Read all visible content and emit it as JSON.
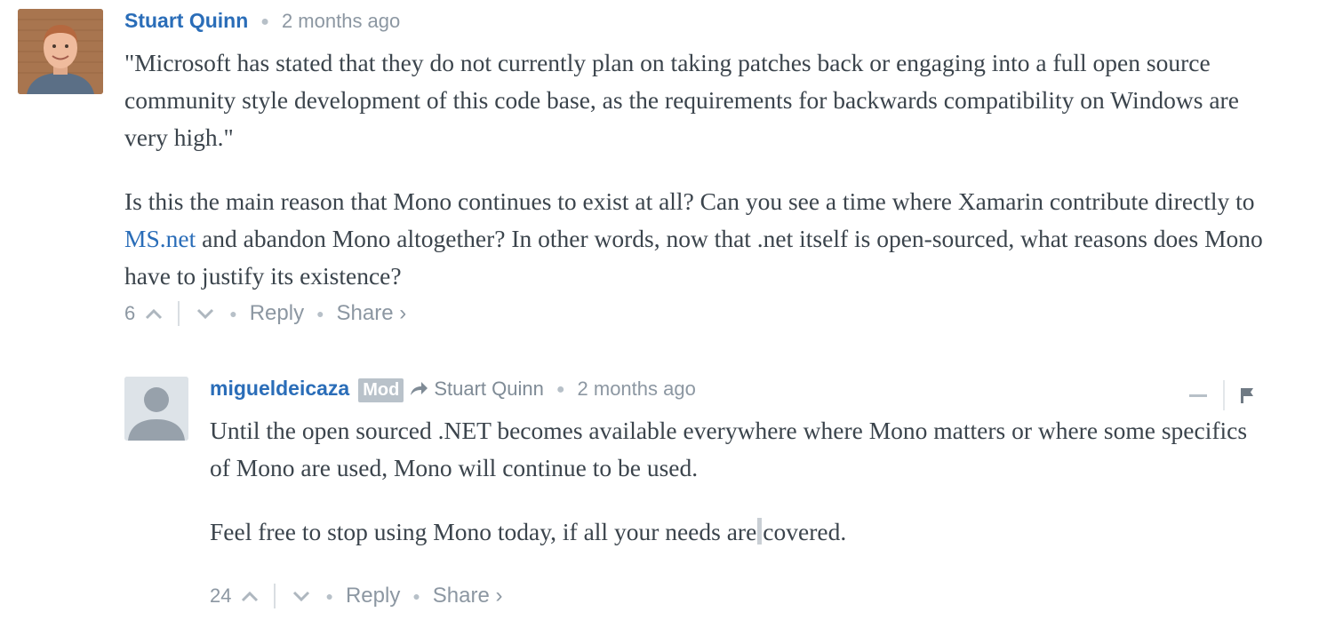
{
  "comments": [
    {
      "author": "Stuart Quinn",
      "time": "2 months ago",
      "avatar_icon": "user-photo",
      "body": {
        "p1": "\"Microsoft has stated that they do not currently plan on taking patches back or engaging into a full open source community style development of this code base, as the requirements for backwards compatibility on Windows are very high.\"",
        "p2_before": "Is this the main reason that Mono continues to exist at all? Can you see a time where Xamarin contribute directly to ",
        "p2_link": "MS.net",
        "p2_after": " and abandon Mono altogether? In other words, now that .net itself is open-sourced, what reasons does Mono have to justify its existence?"
      },
      "votes": "6",
      "reply_label": "Reply",
      "share_label": "Share ›"
    },
    {
      "author": "migueldeicaza",
      "badge": "Mod",
      "reply_to": "Stuart Quinn",
      "time": "2 months ago",
      "avatar_icon": "default-avatar",
      "body": {
        "p1": "Until the open sourced .NET becomes available everywhere where Mono matters or where some specifics of Mono are used, Mono will continue to be used.",
        "p2_before": "Feel free to stop using Mono today, if all your needs are",
        "p2_after": "covered."
      },
      "votes": "24",
      "reply_label": "Reply",
      "share_label": "Share ›"
    }
  ],
  "colors": {
    "link": "#2a6db8",
    "muted": "#8c97a2",
    "body_text": "#3b444c",
    "badge_bg": "#b9c2ca"
  }
}
